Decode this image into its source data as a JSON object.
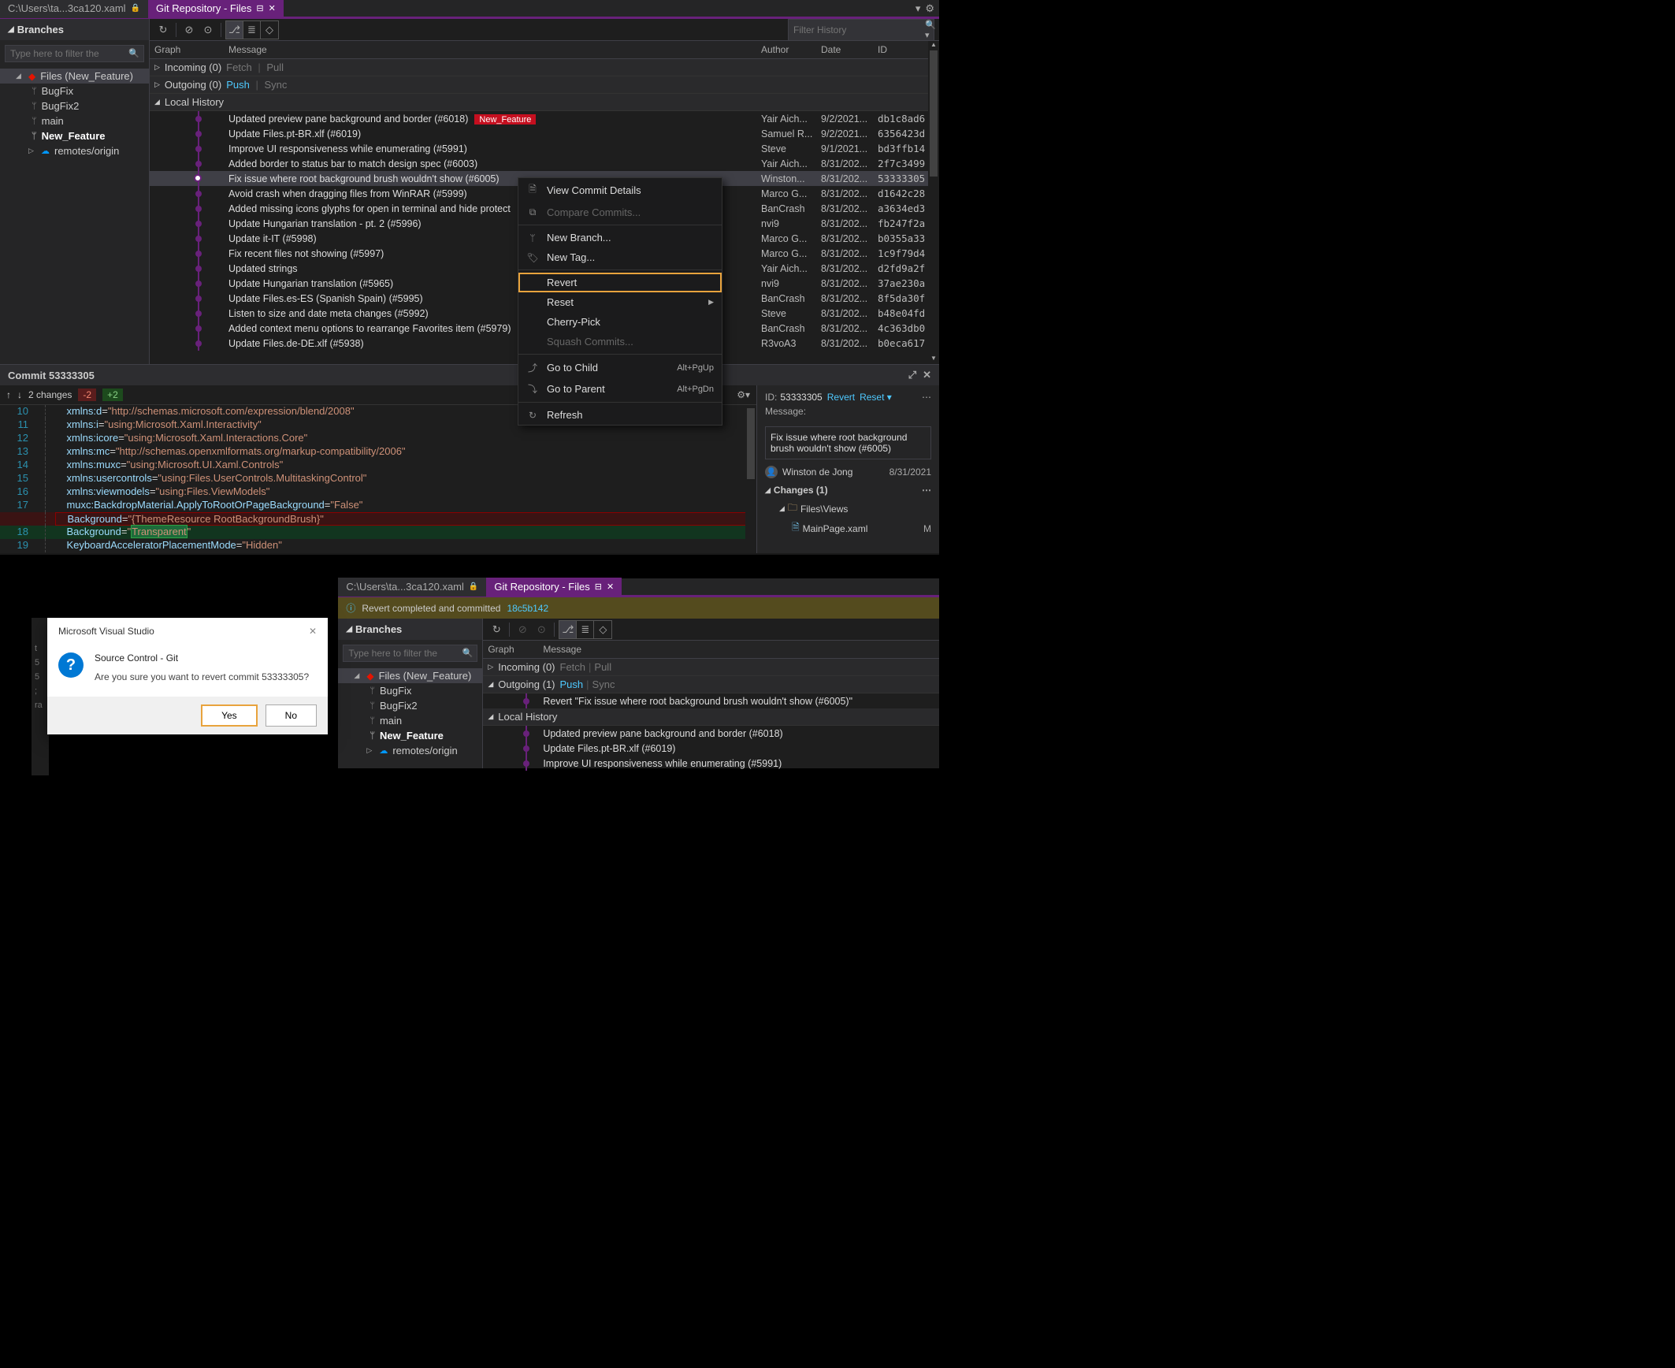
{
  "top": {
    "tabs": {
      "inactive": "C:\\Users\\ta...3ca120.xaml",
      "active": "Git Repository - Files"
    },
    "branches_header": "Branches",
    "filter_placeholder": "Type here to filter the",
    "tree": {
      "files_label": "Files (New_Feature)",
      "branches": [
        "BugFix",
        "BugFix2",
        "main",
        "New_Feature"
      ],
      "remotes": "remotes/origin"
    },
    "filter_history_placeholder": "Filter History",
    "grid_headers": {
      "graph": "Graph",
      "message": "Message",
      "author": "Author",
      "date": "Date",
      "id": "ID"
    },
    "sections": {
      "incoming": "Incoming (0)",
      "outgoing": "Outgoing (0)",
      "local": "Local History",
      "fetch": "Fetch",
      "pull": "Pull",
      "push": "Push",
      "sync": "Sync"
    },
    "commits": [
      {
        "msg": "Updated preview pane background and border (#6018)",
        "badge": "New_Feature",
        "author": "Yair Aich...",
        "date": "9/2/2021...",
        "id": "db1c8ad6"
      },
      {
        "msg": "Update Files.pt-BR.xlf (#6019)",
        "author": "Samuel R...",
        "date": "9/2/2021...",
        "id": "6356423d"
      },
      {
        "msg": "Improve UI responsiveness while enumerating (#5991)",
        "author": "Steve",
        "date": "9/1/2021...",
        "id": "bd3ffb14"
      },
      {
        "msg": "Added border to status bar to match design spec (#6003)",
        "author": "Yair Aich...",
        "date": "8/31/202...",
        "id": "2f7c3499"
      },
      {
        "msg": "Fix issue where root background brush wouldn't show (#6005)",
        "author": "Winston...",
        "date": "8/31/202...",
        "id": "53333305",
        "sel": true
      },
      {
        "msg": " Avoid crash when dragging files from WinRAR (#5999)",
        "author": "Marco G...",
        "date": "8/31/202...",
        "id": "d1642c28"
      },
      {
        "msg": "Added missing icons glyphs for open in terminal and hide protect",
        "author": "BanCrash",
        "date": "8/31/202...",
        "id": "a3634ed3"
      },
      {
        "msg": "Update Hungarian translation - pt. 2 (#5996)",
        "author": "nvi9",
        "date": "8/31/202...",
        "id": "fb247f2a"
      },
      {
        "msg": "Update it-IT (#5998)",
        "author": "Marco G...",
        "date": "8/31/202...",
        "id": "b0355a33"
      },
      {
        "msg": "Fix recent files not showing (#5997)",
        "author": "Marco G...",
        "date": "8/31/202...",
        "id": "1c9f79d4"
      },
      {
        "msg": "Updated strings",
        "author": "Yair Aich...",
        "date": "8/31/202...",
        "id": "d2fd9a2f"
      },
      {
        "msg": "Update Hungarian translation (#5965)",
        "author": "nvi9",
        "date": "8/31/202...",
        "id": "37ae230a"
      },
      {
        "msg": "Update Files.es-ES (Spanish Spain) (#5995)",
        "author": "BanCrash",
        "date": "8/31/202...",
        "id": "8f5da30f"
      },
      {
        "msg": "Listen to size and date meta changes (#5992)",
        "author": "Steve",
        "date": "8/31/202...",
        "id": "b48e04fd"
      },
      {
        "msg": "Added context menu options to rearrange Favorites item (#5979)",
        "author": "BanCrash",
        "date": "8/31/202...",
        "id": "4c363db0"
      },
      {
        "msg": "Update Files.de-DE.xlf (#5938)",
        "author": "R3voA3",
        "date": "8/31/202...",
        "id": "b0eca617"
      }
    ],
    "context_menu": {
      "view_details": "View Commit Details",
      "compare": "Compare Commits...",
      "new_branch": "New Branch...",
      "new_tag": "New Tag...",
      "revert": "Revert",
      "reset": "Reset",
      "cherry": "Cherry-Pick",
      "squash": "Squash Commits...",
      "go_child": "Go to Child",
      "go_child_sc": "Alt+PgUp",
      "go_parent": "Go to Parent",
      "go_parent_sc": "Alt+PgDn",
      "refresh": "Refresh"
    },
    "detail": {
      "header": "Commit 53333305",
      "changes": "2 changes",
      "neg": "-2",
      "pos": "+2",
      "id_label": "ID:",
      "id": "53333305",
      "revert": "Revert",
      "reset": "Reset",
      "msg_label": "Message:",
      "msg": "Fix issue where root background brush wouldn't show (#6005)",
      "author": "Winston de Jong",
      "date": "8/31/2021",
      "changes_header": "Changes (1)",
      "folder": "Files\\Views",
      "file": "MainPage.xaml",
      "file_status": "M"
    }
  },
  "dialog": {
    "title": "Microsoft Visual Studio",
    "header": "Source Control - Git",
    "text": "Are you sure you want to revert commit 53333305?",
    "yes": "Yes",
    "no": "No"
  },
  "bottom": {
    "tabs": {
      "inactive": "C:\\Users\\ta...3ca120.xaml",
      "active": "Git Repository - Files"
    },
    "info": "Revert completed and committed",
    "info_hash": "18c5b142",
    "branches_header": "Branches",
    "filter_placeholder": "Type here to filter the",
    "tree": {
      "files_label": "Files (New_Feature)",
      "branches": [
        "BugFix",
        "BugFix2",
        "main",
        "New_Feature"
      ],
      "remotes": "remotes/origin"
    },
    "grid_headers": {
      "graph": "Graph",
      "message": "Message"
    },
    "sections": {
      "incoming": "Incoming (0)",
      "outgoing": "Outgoing (1)",
      "local": "Local History",
      "fetch": "Fetch",
      "pull": "Pull",
      "push": "Push",
      "sync": "Sync"
    },
    "outgoing_commit": "Revert \"Fix issue where root background brush wouldn't show (#6005)\"",
    "commits": [
      "Updated preview pane background and border (#6018)",
      "Update Files.pt-BR.xlf (#6019)",
      "Improve UI responsiveness while enumerating (#5991)"
    ]
  }
}
